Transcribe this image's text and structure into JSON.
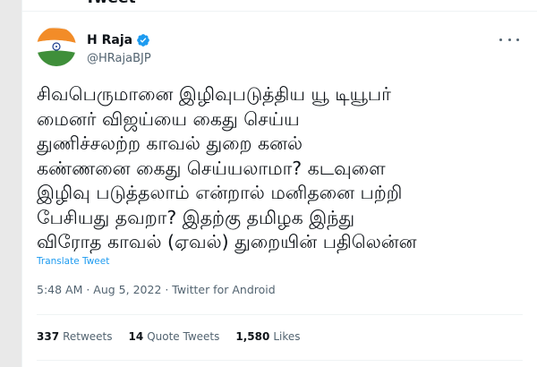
{
  "header": {
    "title": "Tweet"
  },
  "author": {
    "name": "H Raja",
    "handle": "@HRajaBJP",
    "verified": true
  },
  "tweet": {
    "text": "சிவபெருமானை இழிவுபடுத்திய யூ டியூபர்\nமைனர் விஜய்யை கைது செய்ய\nதுணிச்சலற்ற காவல் துறை  கனல்\nகண்ணனை கைது செய்யலாமா? கடவுளை\nஇழிவு படுத்தலாம் என்றால் மனிதனை பற்றி\nபேசியது தவறா? இதற்கு தமிழக இந்து\nவிரோத காவல் (ஏவல்) துறையின் பதிலென்ன",
    "translate_label": "Translate Tweet",
    "timestamp": "5:48 AM · Aug 5, 2022 · Twitter for Android"
  },
  "stats": {
    "retweets": {
      "count": "337",
      "label": "Retweets"
    },
    "quotes": {
      "count": "14",
      "label": "Quote Tweets"
    },
    "likes": {
      "count": "1,580",
      "label": "Likes"
    }
  },
  "colors": {
    "accent": "#1d9bf0",
    "text": "#0f1419",
    "muted": "#536471"
  },
  "icons": {
    "verified": "verified-badge-icon",
    "more": "more-options-icon"
  }
}
